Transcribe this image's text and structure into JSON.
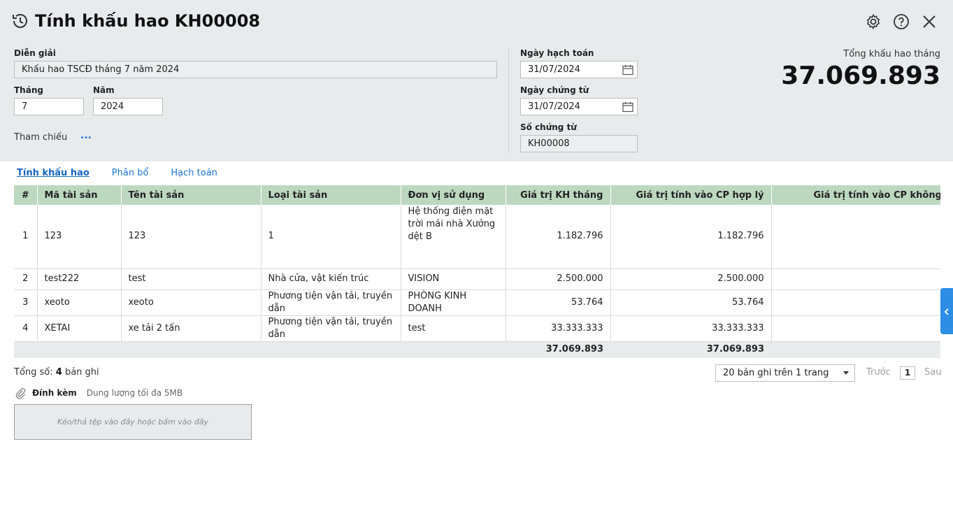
{
  "header": {
    "title": "Tính khấu hao KH00008",
    "icons": [
      "history-icon",
      "settings-icon",
      "help-icon",
      "close-icon"
    ]
  },
  "form": {
    "description_label": "Diễn giải",
    "description_value": "Khấu hao TSCĐ tháng 7 năm 2024",
    "month_label": "Tháng",
    "month_value": "7",
    "year_label": "Năm",
    "year_value": "2024",
    "reference_label": "Tham chiếu",
    "reference_more": "...",
    "posting_date_label": "Ngày hạch toán",
    "posting_date_value": "31/07/2024",
    "voucher_date_label": "Ngày chứng từ",
    "voucher_date_value": "31/07/2024",
    "voucher_no_label": "Số chứng từ",
    "voucher_no_value": "KH00008"
  },
  "summary": {
    "total_label": "Tổng khấu hao tháng",
    "total_value": "37.069.893"
  },
  "tabs": [
    {
      "label": "Tính khấu hao",
      "active": true
    },
    {
      "label": "Phân bổ",
      "active": false
    },
    {
      "label": "Hạch toán",
      "active": false
    }
  ],
  "table": {
    "columns": [
      "#",
      "Mã tài sản",
      "Tên tài sản",
      "Loại tài sản",
      "Đơn vị sử dụng",
      "Giá trị KH tháng",
      "Giá trị tính vào CP hợp lý",
      "Giá trị tính vào CP không hợp lý"
    ],
    "rows": [
      {
        "no": "1",
        "code": "123",
        "name": "123",
        "type": "1",
        "unit": "Hệ thống điện mặt trời mái nhà Xưởng dệt B",
        "monthly": "1.182.796",
        "reasonable": "1.182.796",
        "unreasonable": ""
      },
      {
        "no": "2",
        "code": "test222",
        "name": "test",
        "type": "Nhà cửa, vật kiến trúc",
        "unit": "VISION",
        "monthly": "2.500.000",
        "reasonable": "2.500.000",
        "unreasonable": ""
      },
      {
        "no": "3",
        "code": "xeoto",
        "name": "xeoto",
        "type": "Phương tiện vận tải, truyền dẫn",
        "unit": "PHÒNG KINH DOANH",
        "monthly": "53.764",
        "reasonable": "53.764",
        "unreasonable": ""
      },
      {
        "no": "4",
        "code": "XETAI",
        "name": "xe tải 2 tấn",
        "type": "Phương tiện vận tải, truyền dẫn",
        "unit": "test",
        "monthly": "33.333.333",
        "reasonable": "33.333.333",
        "unreasonable": ""
      }
    ],
    "footer": {
      "monthly": "37.069.893",
      "reasonable": "37.069.893"
    }
  },
  "pager": {
    "total_prefix": "Tổng số: ",
    "total_count": "4",
    "total_suffix": " bản ghi",
    "page_size": "20 bản ghi trên 1 trang",
    "prev": "Trước",
    "page": "1",
    "next": "Sau"
  },
  "attachment": {
    "label": "Đính kèm",
    "hint": "Dung lượng tối đa 5MB",
    "dropzone": "Kéo/thả tệp vào đây hoặc bấm vào đây"
  },
  "colors": {
    "header_bg": "#e8ebec",
    "grid_header": "#bcd8c0",
    "link": "#1976d2",
    "side_handle": "#2e8ee6"
  }
}
